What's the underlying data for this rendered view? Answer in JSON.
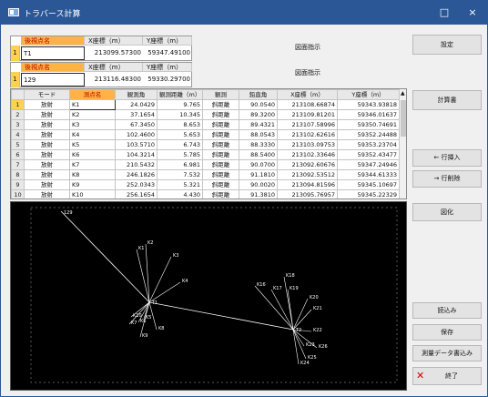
{
  "window": {
    "title": "トラバース計算",
    "minimize_label": "□",
    "close_label": "×"
  },
  "back_sight": {
    "row_num": "1",
    "name_header": "後視点名",
    "x_header": "X座標（m）",
    "y_header": "Y座標（m）",
    "name": "T1",
    "x": "213099.57300",
    "y": "59347.49100",
    "pick_label": "図面指示"
  },
  "fore_sight": {
    "row_num": "1",
    "name_header": "後視点名",
    "x_header": "X座標（m）",
    "y_header": "Y座標（m）",
    "name": "129",
    "x": "213116.48300",
    "y": "59330.29700",
    "pick_label": "図面指示"
  },
  "table": {
    "columns": [
      "モード",
      "測点名",
      "観測角",
      "観測距離（m）",
      "観測",
      "鉛直角",
      "X座標（m）",
      "Y座標（m）"
    ],
    "rows": [
      {
        "n": "1",
        "mode": "放射",
        "name": "K1",
        "angle": "24.0429",
        "dist": "9.765",
        "kind": "斜距離",
        "vert": "90.0540",
        "x": "213108.66874",
        "y": "59343.93818"
      },
      {
        "n": "2",
        "mode": "放射",
        "name": "K2",
        "angle": "37.1654",
        "dist": "10.345",
        "kind": "斜距離",
        "vert": "89.3200",
        "x": "213109.81201",
        "y": "59346.01637"
      },
      {
        "n": "3",
        "mode": "放射",
        "name": "K3",
        "angle": "67.3450",
        "dist": "8.653",
        "kind": "斜距離",
        "vert": "89.4321",
        "x": "213107.58996",
        "y": "59350.74691"
      },
      {
        "n": "4",
        "mode": "放射",
        "name": "K4",
        "angle": "102.4600",
        "dist": "5.653",
        "kind": "斜距離",
        "vert": "88.0543",
        "x": "213102.62616",
        "y": "59352.24488"
      },
      {
        "n": "5",
        "mode": "放射",
        "name": "K5",
        "angle": "103.5710",
        "dist": "6.743",
        "kind": "斜距離",
        "vert": "88.3330",
        "x": "213103.09753",
        "y": "59353.23704"
      },
      {
        "n": "6",
        "mode": "放射",
        "name": "K6",
        "angle": "104.3214",
        "dist": "5.785",
        "kind": "斜距離",
        "vert": "88.5400",
        "x": "213102.33646",
        "y": "59352.43477"
      },
      {
        "n": "7",
        "mode": "放射",
        "name": "K7",
        "angle": "210.5432",
        "dist": "6.981",
        "kind": "斜距離",
        "vert": "90.0700",
        "x": "213092.60676",
        "y": "59347.24946"
      },
      {
        "n": "8",
        "mode": "放射",
        "name": "K8",
        "angle": "246.1826",
        "dist": "7.532",
        "kind": "斜距離",
        "vert": "91.1810",
        "x": "213092.53512",
        "y": "59344.61333"
      },
      {
        "n": "9",
        "mode": "放射",
        "name": "K9",
        "angle": "252.0343",
        "dist": "5.321",
        "kind": "斜距離",
        "vert": "90.0020",
        "x": "213094.81596",
        "y": "59345.10697"
      },
      {
        "n": "10",
        "mode": "放射",
        "name": "K10",
        "angle": "256.1654",
        "dist": "4.430",
        "kind": "斜距離",
        "vert": "91.3810",
        "x": "213095.76957",
        "y": "59345.22329"
      }
    ]
  },
  "buttons": {
    "settings": "設定",
    "report": "計算書",
    "insert_row": "← 行挿入",
    "delete_row": "→ 行削除",
    "figure": "図化",
    "load": "読込み",
    "save": "保存",
    "import": "測量データ書込み",
    "exit": "終了"
  },
  "plot_labels": {
    "station_a": "T1",
    "station_b": "T2",
    "back_point": "129",
    "radials_a": [
      "K1",
      "K2",
      "K3",
      "K4",
      "K5",
      "K6",
      "K7",
      "K8",
      "K9",
      "K10"
    ],
    "radials_b": [
      "K16",
      "K17",
      "K18",
      "K19",
      "K20",
      "K21",
      "K22",
      "K23",
      "K24",
      "K25",
      "K26"
    ]
  }
}
